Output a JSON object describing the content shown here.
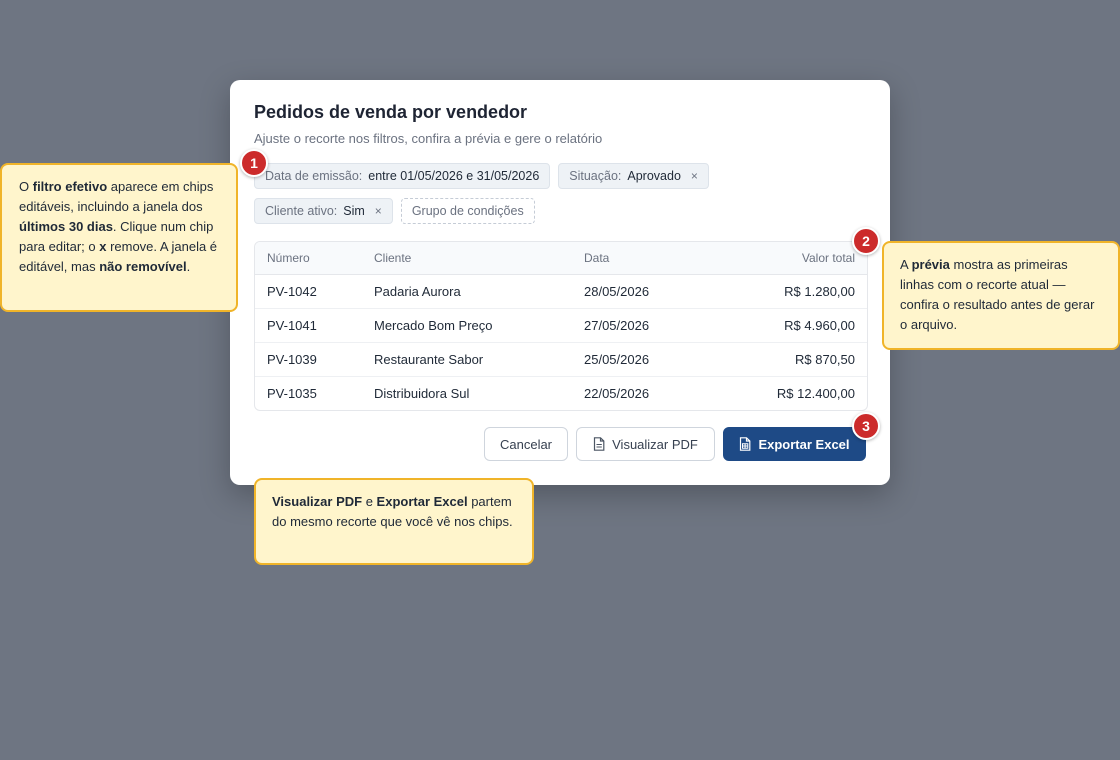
{
  "modal": {
    "title": "Pedidos de venda por vendedor",
    "subtitle": "Ajuste o recorte nos filtros, confira a prévia e gere o relatório"
  },
  "chips": [
    {
      "key": "Data de emissão:",
      "value": "entre 01/05/2026 e 31/05/2026"
    },
    {
      "key": "Situação:",
      "value": "Aprovado",
      "remove": "×"
    },
    {
      "key": "Cliente ativo:",
      "value": "Sim",
      "remove": "×"
    },
    {
      "label": "Grupo de condições"
    }
  ],
  "table": {
    "headers": [
      "Número",
      "Cliente",
      "Data",
      "Valor total"
    ],
    "rows": [
      [
        "PV-1042",
        "Padaria Aurora",
        "28/05/2026",
        "R$ 1.280,00"
      ],
      [
        "PV-1041",
        "Mercado Bom Preço",
        "27/05/2026",
        "R$ 4.960,00"
      ],
      [
        "PV-1039",
        "Restaurante Sabor",
        "25/05/2026",
        "R$ 870,50"
      ],
      [
        "PV-1035",
        "Distribuidora Sul",
        "22/05/2026",
        "R$ 12.400,00"
      ]
    ]
  },
  "buttons": {
    "cancel": "Cancelar",
    "pdf": "Visualizar PDF",
    "excel": "Exportar Excel",
    "pdf_icon": "file-icon",
    "excel_icon": "spreadsheet-icon"
  },
  "callouts": [
    {
      "badge": "1",
      "parts": [
        "O ",
        "filtro efetivo",
        " aparece em chips editáveis, incluindo a janela dos ",
        "últimos 30 dias",
        ". Clique num chip para editar; o ",
        "x",
        " remove. A janela é editável, mas ",
        "não removível",
        "."
      ]
    },
    {
      "badge": "2",
      "parts": [
        "A ",
        "prévia",
        " mostra as primeiras linhas com o recorte atual — confira o resultado antes de gerar o arquivo."
      ]
    },
    {
      "badge": "3",
      "parts": [
        "Visualizar PDF",
        " e ",
        "Exportar Excel",
        " partem do mesmo recorte que você vê nos chips."
      ]
    }
  ],
  "colors": {
    "overlay": "#6e7582",
    "primary": "#1e4a86",
    "callout_bg": "#fff5cc",
    "callout_border": "#f0b429",
    "badge": "#cc2b2b"
  }
}
